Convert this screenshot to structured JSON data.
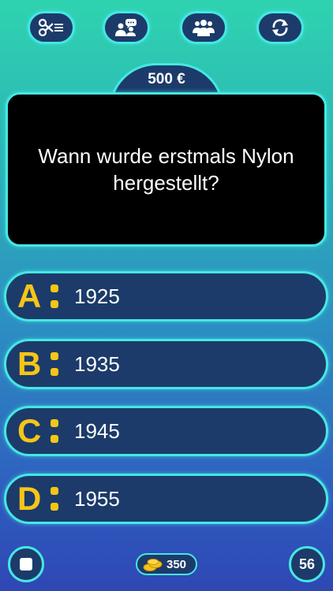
{
  "lifelines": {
    "fifty_fifty_icon": "scissors-list-icon",
    "ask_friend_icon": "two-people-chat-icon",
    "ask_audience_icon": "audience-icon",
    "switch_question_icon": "refresh-icon"
  },
  "prize": {
    "amount": "500 €"
  },
  "question": {
    "text": "Wann wurde erstmals Nylon hergestellt?"
  },
  "answers": [
    {
      "letter": "A",
      "text": "1925"
    },
    {
      "letter": "B",
      "text": "1935"
    },
    {
      "letter": "C",
      "text": "1945"
    },
    {
      "letter": "D",
      "text": "1955"
    }
  ],
  "footer": {
    "stop_icon": "stop-icon",
    "coins_icon": "coins-icon",
    "coins": "350",
    "timer": "56"
  },
  "colors": {
    "accent": "#45e7e3",
    "panel": "#1c3b6a",
    "letter": "#f5c518",
    "bg_top": "#2fd3b0",
    "bg_bottom": "#2f47b3"
  }
}
